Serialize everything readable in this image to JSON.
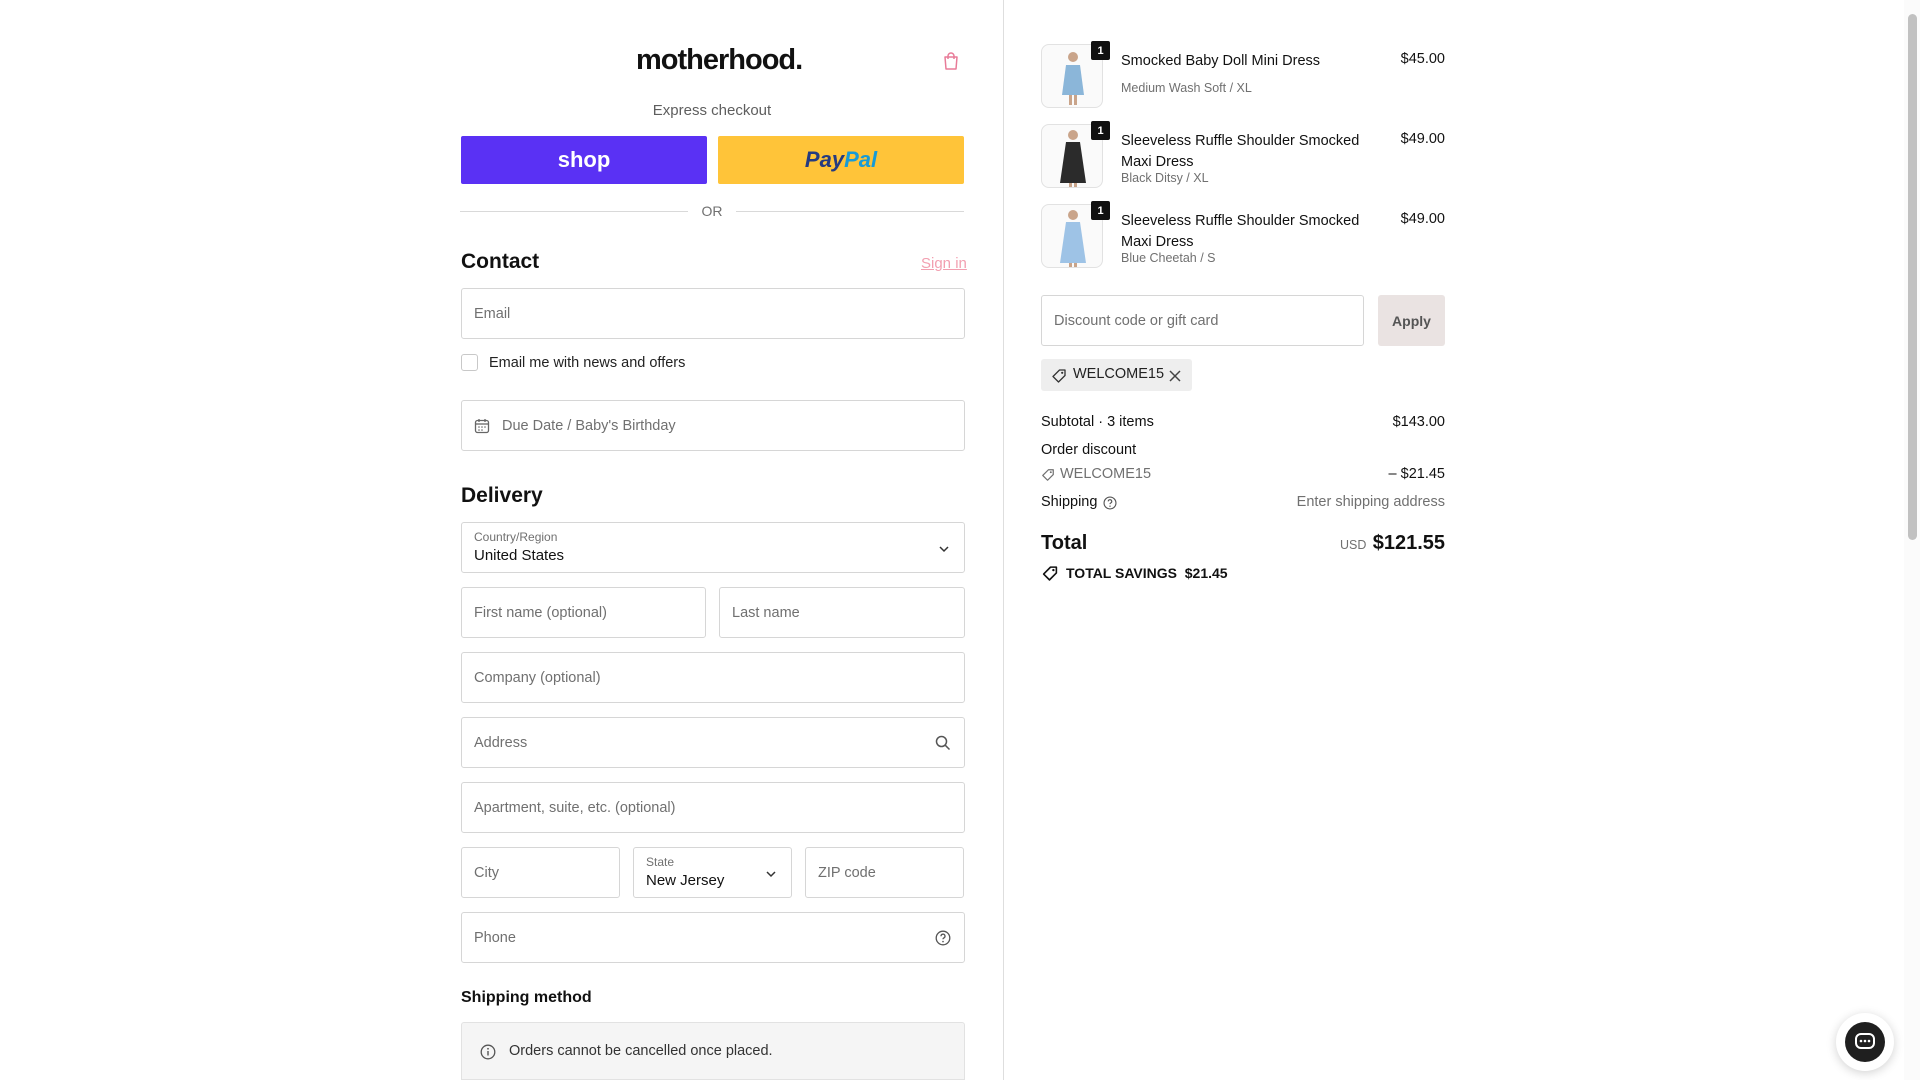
{
  "brand": {
    "logo_text": "motherhood."
  },
  "express": {
    "title": "Express checkout",
    "shop_label": "shop",
    "paypal_label_1": "Pay",
    "paypal_label_2": "Pal",
    "or_label": "OR"
  },
  "contact": {
    "heading": "Contact",
    "signin_label": "Sign in",
    "email_placeholder": "Email",
    "news_label": "Email me with news and offers",
    "due_date_placeholder": "Due Date / Baby's Birthday"
  },
  "delivery": {
    "heading": "Delivery",
    "country_label": "Country/Region",
    "country_value": "United States",
    "first_name_placeholder": "First name (optional)",
    "last_name_placeholder": "Last name",
    "company_placeholder": "Company (optional)",
    "address_placeholder": "Address",
    "apartment_placeholder": "Apartment, suite, etc. (optional)",
    "city_placeholder": "City",
    "state_label": "State",
    "state_value": "New Jersey",
    "zip_placeholder": "ZIP code",
    "phone_placeholder": "Phone"
  },
  "shipping_method": {
    "heading": "Shipping method",
    "notice": "Orders cannot be cancelled once placed."
  },
  "cart": {
    "items": [
      {
        "qty": "1",
        "name": "Smocked Baby Doll Mini Dress",
        "variant": "Medium Wash Soft / XL",
        "price": "$45.00",
        "color": "#8bb6d9"
      },
      {
        "qty": "1",
        "name": "Sleeveless Ruffle Shoulder Smocked Maxi Dress",
        "variant": "Black Ditsy / XL",
        "price": "$49.00",
        "color": "#2b2b2b"
      },
      {
        "qty": "1",
        "name": "Sleeveless Ruffle Shoulder Smocked Maxi Dress",
        "variant": "Blue Cheetah / S",
        "price": "$49.00",
        "color": "#9ec3e6"
      }
    ],
    "discount_placeholder": "Discount code or gift card",
    "apply_label": "Apply",
    "applied_code": "WELCOME15"
  },
  "summary": {
    "subtotal_label": "Subtotal · 3 items",
    "subtotal_value": "$143.00",
    "order_discount_label": "Order discount",
    "discount_code": "WELCOME15",
    "discount_value": "– $21.45",
    "shipping_label": "Shipping",
    "shipping_value": "Enter shipping address",
    "total_label": "Total",
    "currency": "USD",
    "total_value": "$121.55",
    "savings_label": "TOTAL SAVINGS",
    "savings_value": "$21.45"
  },
  "colors": {
    "shop_pay": "#5a31f4",
    "paypal": "#ffc439",
    "signin_link": "#f29fb0",
    "brand_pink": "#e87b98"
  }
}
